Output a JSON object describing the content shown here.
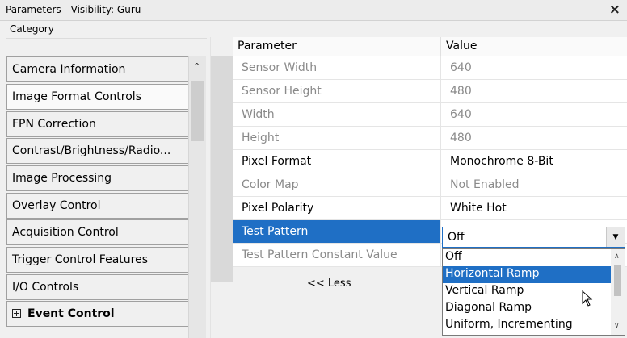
{
  "window": {
    "title": "Parameters - Visibility: Guru",
    "close_glyph": "×"
  },
  "category_panel": {
    "header": "Category",
    "items": [
      {
        "label": "Camera Information"
      },
      {
        "label": "Image Format Controls",
        "selected": true
      },
      {
        "label": "FPN Correction"
      },
      {
        "label": "Contrast/Brightness/Radio..."
      },
      {
        "label": "Image Processing"
      },
      {
        "label": "Overlay Control"
      },
      {
        "label": "Acquisition Control"
      },
      {
        "label": "Trigger Control Features"
      },
      {
        "label": "I/O Controls"
      },
      {
        "label": "Event Control",
        "bold": true,
        "expandable": true
      }
    ],
    "scroll_up_glyph": "^"
  },
  "parameter_grid": {
    "columns": {
      "parameter": "Parameter",
      "value": "Value"
    },
    "rows": [
      {
        "name": "Sensor Width",
        "value": "640",
        "readonly": true
      },
      {
        "name": "Sensor Height",
        "value": "480",
        "readonly": true
      },
      {
        "name": "Width",
        "value": "640",
        "readonly": true
      },
      {
        "name": "Height",
        "value": "480",
        "readonly": true
      },
      {
        "name": "Pixel Format",
        "value": "Monochrome 8-Bit",
        "readonly": false
      },
      {
        "name": "Color Map",
        "value": "Not Enabled",
        "readonly": true
      },
      {
        "name": "Pixel Polarity",
        "value": "White Hot",
        "readonly": false
      },
      {
        "name": "Test Pattern",
        "value": "Off",
        "readonly": false,
        "selected": true
      },
      {
        "name": "Test Pattern Constant Value",
        "value": "",
        "readonly": true
      }
    ],
    "less_button": "<< Less"
  },
  "test_pattern_dropdown": {
    "value": "Off",
    "arrow_glyph": "▼",
    "options": [
      "Off",
      "Horizontal Ramp",
      "Vertical Ramp",
      "Diagonal Ramp",
      "Uniform, Incrementing"
    ],
    "highlighted": "Horizontal Ramp",
    "scroll_up_glyph": "∧",
    "scroll_down_glyph": "∨"
  },
  "colors": {
    "selection": "#1f6fc5",
    "readonly_text": "#8a8a8a"
  }
}
